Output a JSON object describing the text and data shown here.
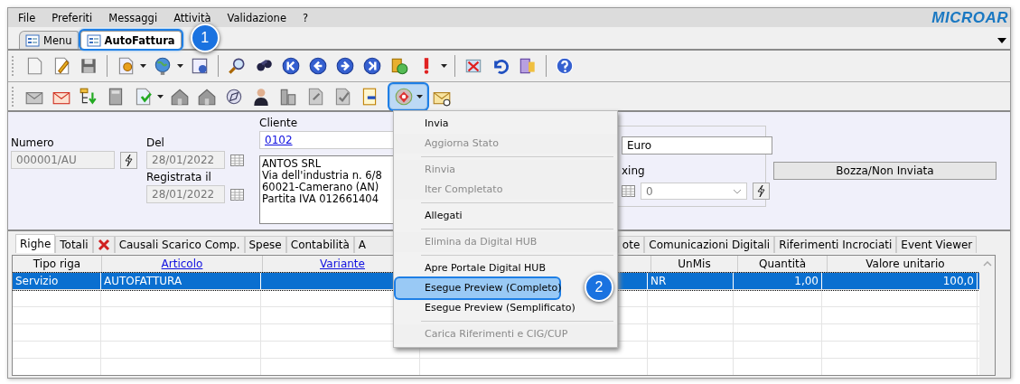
{
  "menu_bar": {
    "items": [
      "File",
      "Preferiti",
      "Messaggi",
      "Attività",
      "Validazione",
      "?"
    ],
    "logo": "MICROAR"
  },
  "document_tabs": [
    {
      "label": "Menu",
      "selected": false,
      "highlighted": false
    },
    {
      "label": "AutoFattura",
      "selected": true,
      "highlighted": true,
      "callout": "1"
    }
  ],
  "toolbar_2": {
    "digital_hub_button": {
      "open": true,
      "highlighted": true
    }
  },
  "form": {
    "numero": {
      "label": "Numero",
      "value": "000001/AU"
    },
    "del": {
      "label": "Del",
      "value": "28/01/2022"
    },
    "registrata": {
      "label": "Registrata il",
      "value": "28/01/2022"
    },
    "cliente": {
      "label": "Cliente",
      "code": "0102",
      "address": [
        "ANTOS SRL",
        "Via dell'industria n. 6/8",
        "60021-Camerano (AN)",
        "Partita IVA 012661404"
      ]
    },
    "currency": {
      "value": "Euro"
    },
    "fixing": {
      "label": "xing",
      "value": "0"
    },
    "status": {
      "value": "Bozza/Non Inviata"
    }
  },
  "tabs": [
    {
      "kind": "text",
      "label": "Righe",
      "selected": true
    },
    {
      "kind": "text",
      "label": "Totali",
      "selected": false
    },
    {
      "kind": "icon",
      "selected": false
    },
    {
      "kind": "text",
      "label": "Causali Scarico Comp.",
      "selected": false
    },
    {
      "kind": "text",
      "label": "Spese",
      "selected": false
    },
    {
      "kind": "text",
      "label": "Contabilità",
      "selected": false
    },
    {
      "kind": "covered",
      "label": "A",
      "selected": false
    },
    {
      "kind": "text",
      "label": "ote",
      "selected": false
    },
    {
      "kind": "text",
      "label": "Comunicazioni Digitali",
      "selected": false
    },
    {
      "kind": "text",
      "label": "Riferimenti Incrociati",
      "selected": false
    },
    {
      "kind": "text",
      "label": "Event Viewer",
      "selected": false
    }
  ],
  "table": {
    "columns": [
      {
        "label": "Tipo riga",
        "link": false
      },
      {
        "label": "Articolo",
        "link": true
      },
      {
        "label": "Variante",
        "link": true
      },
      {
        "link": false
      },
      {
        "label": "UnMis",
        "link": false
      },
      {
        "label": "Quantità",
        "link": false
      },
      {
        "label": "Valore unitario",
        "link": false
      }
    ],
    "rows": [
      {
        "selected": true,
        "cells": [
          "Servizio",
          "AUTOFATTURA",
          "",
          "",
          "NR",
          "1,00",
          "100,0"
        ]
      }
    ]
  },
  "popup_menu": {
    "items": [
      {
        "kind": "item",
        "label": "Invia",
        "disabled": false,
        "highlighted": false
      },
      {
        "kind": "item",
        "label": "Aggiorna Stato",
        "disabled": true,
        "highlighted": false
      },
      {
        "kind": "separator"
      },
      {
        "kind": "item",
        "label": "Rinvia",
        "disabled": true,
        "highlighted": false
      },
      {
        "kind": "item",
        "label": "Iter Completato",
        "disabled": true,
        "highlighted": false
      },
      {
        "kind": "separator"
      },
      {
        "kind": "item",
        "label": "Allegati",
        "disabled": false,
        "highlighted": false
      },
      {
        "kind": "separator"
      },
      {
        "kind": "item",
        "label": "Elimina da Digital HUB",
        "disabled": true,
        "highlighted": false
      },
      {
        "kind": "separator"
      },
      {
        "kind": "item",
        "label": "Apre Portale Digital HUB",
        "disabled": false,
        "highlighted": false
      },
      {
        "kind": "item",
        "label": "Esegue Preview (Completo)",
        "disabled": false,
        "highlighted": true,
        "callout": "2"
      },
      {
        "kind": "item",
        "label": "Esegue Preview (Semplificato)",
        "disabled": false,
        "highlighted": false
      },
      {
        "kind": "separator"
      },
      {
        "kind": "item",
        "label": "Carica Riferimenti e CIG/CUP",
        "disabled": true,
        "highlighted": false
      }
    ]
  }
}
